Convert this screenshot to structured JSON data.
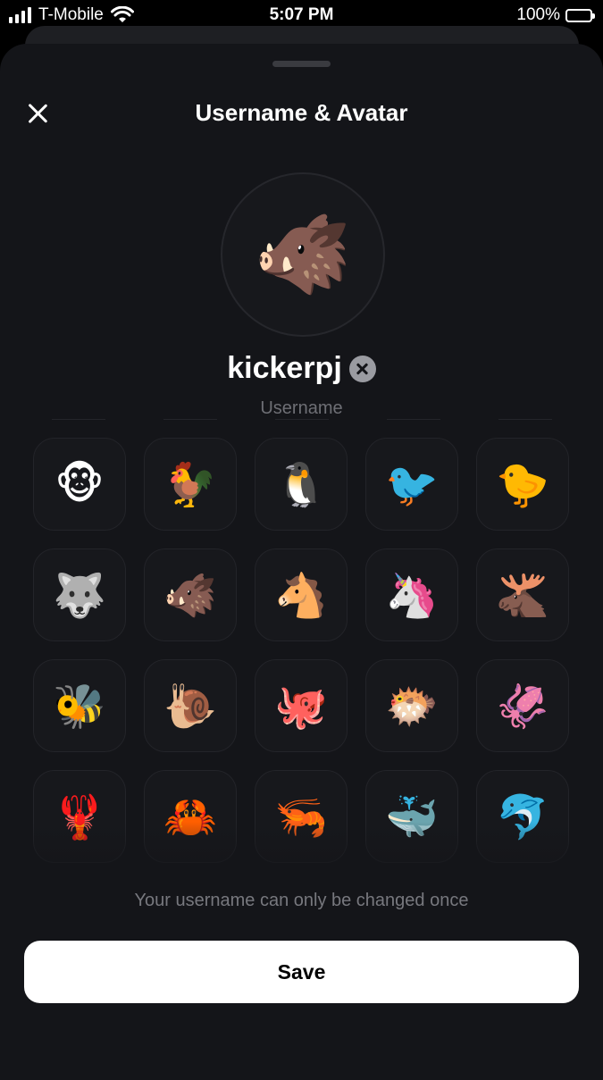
{
  "status_bar": {
    "carrier": "T-Mobile",
    "time": "5:07 PM",
    "battery": "100%",
    "signal_icon": "signal-bars-icon",
    "wifi_icon": "wifi-icon",
    "battery_icon": "battery-icon",
    "battery_color": "#f2c321"
  },
  "sheet": {
    "title": "Username & Avatar",
    "close_icon": "close-icon"
  },
  "avatar": {
    "selected": "🐗"
  },
  "username": {
    "value": "kickerpj",
    "label": "Username",
    "clear_icon": "clear-x-icon"
  },
  "emojis": [
    {
      "glyph": "🐵",
      "name": "monkey"
    },
    {
      "glyph": "🐓",
      "name": "rooster"
    },
    {
      "glyph": "🐧",
      "name": "puffin"
    },
    {
      "glyph": "🐦",
      "name": "pigeon"
    },
    {
      "glyph": "🐤",
      "name": "chick"
    },
    {
      "glyph": "🐺",
      "name": "wolf"
    },
    {
      "glyph": "🐗",
      "name": "boar"
    },
    {
      "glyph": "🐴",
      "name": "horse"
    },
    {
      "glyph": "🦄",
      "name": "unicorn"
    },
    {
      "glyph": "🫎",
      "name": "moose"
    },
    {
      "glyph": "🐝",
      "name": "bee"
    },
    {
      "glyph": "🐌",
      "name": "snail"
    },
    {
      "glyph": "🐙",
      "name": "octopus"
    },
    {
      "glyph": "🐡",
      "name": "pufferfish"
    },
    {
      "glyph": "🦑",
      "name": "squid"
    },
    {
      "glyph": "🦞",
      "name": "lobster"
    },
    {
      "glyph": "🦀",
      "name": "crab"
    },
    {
      "glyph": "🦐",
      "name": "shrimp"
    },
    {
      "glyph": "🐳",
      "name": "whale"
    },
    {
      "glyph": "🐬",
      "name": "dolphin"
    }
  ],
  "footer": {
    "note": "Your username can only be changed once",
    "save_label": "Save"
  }
}
